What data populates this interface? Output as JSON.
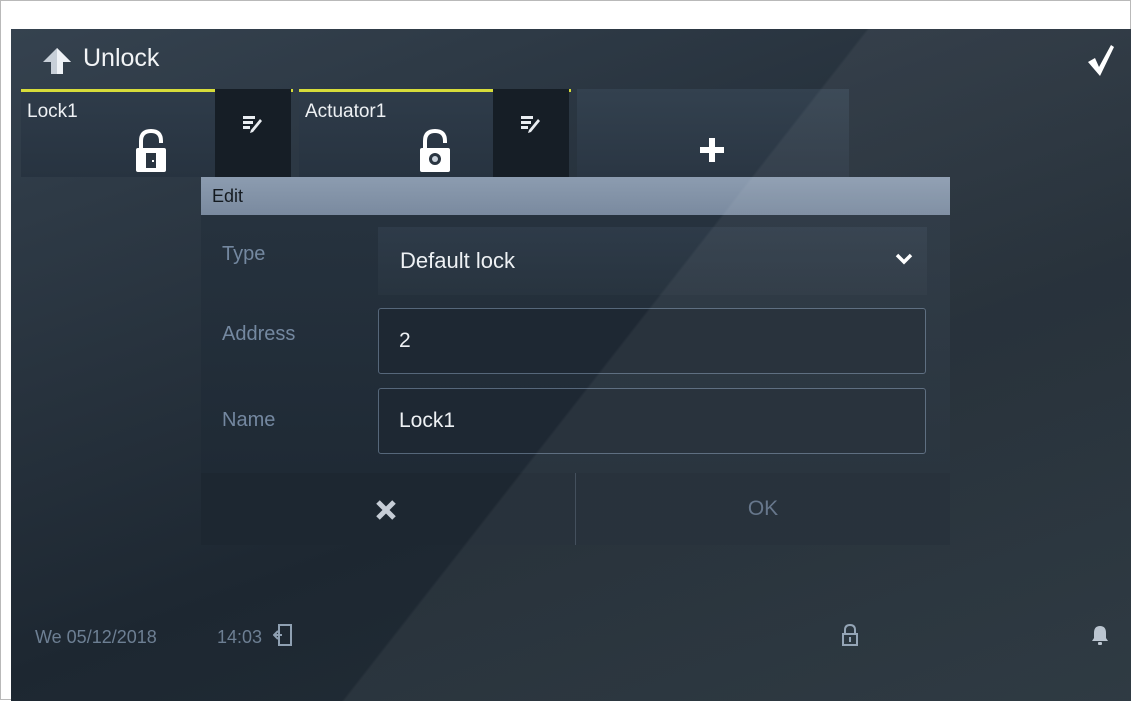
{
  "header": {
    "title": "Unlock",
    "back_icon": "arrow-up-icon",
    "confirm_icon": "checkmark-icon"
  },
  "tiles": [
    {
      "label": "Lock1",
      "icon": "lock-door-icon",
      "edit_icon": "edit-icon"
    },
    {
      "label": "Actuator1",
      "icon": "lock-camera-icon",
      "edit_icon": "edit-icon"
    }
  ],
  "add_tile": {
    "icon": "plus-icon"
  },
  "dialog": {
    "title": "Edit",
    "fields": {
      "type_label": "Type",
      "type_value": "Default lock",
      "address_label": "Address",
      "address_value": "2",
      "name_label": "Name",
      "name_value": "Lock1"
    },
    "cancel_icon": "close-icon",
    "ok_label": "OK"
  },
  "status_bar": {
    "date": "We 05/12/2018",
    "time": "14:03",
    "icons": [
      "door-exit-icon",
      "padlock-icon",
      "bell-icon"
    ]
  },
  "colors": {
    "accent": "#d7dc3a",
    "dialog_header": "#8c9cb0",
    "label": "#7488a0"
  }
}
